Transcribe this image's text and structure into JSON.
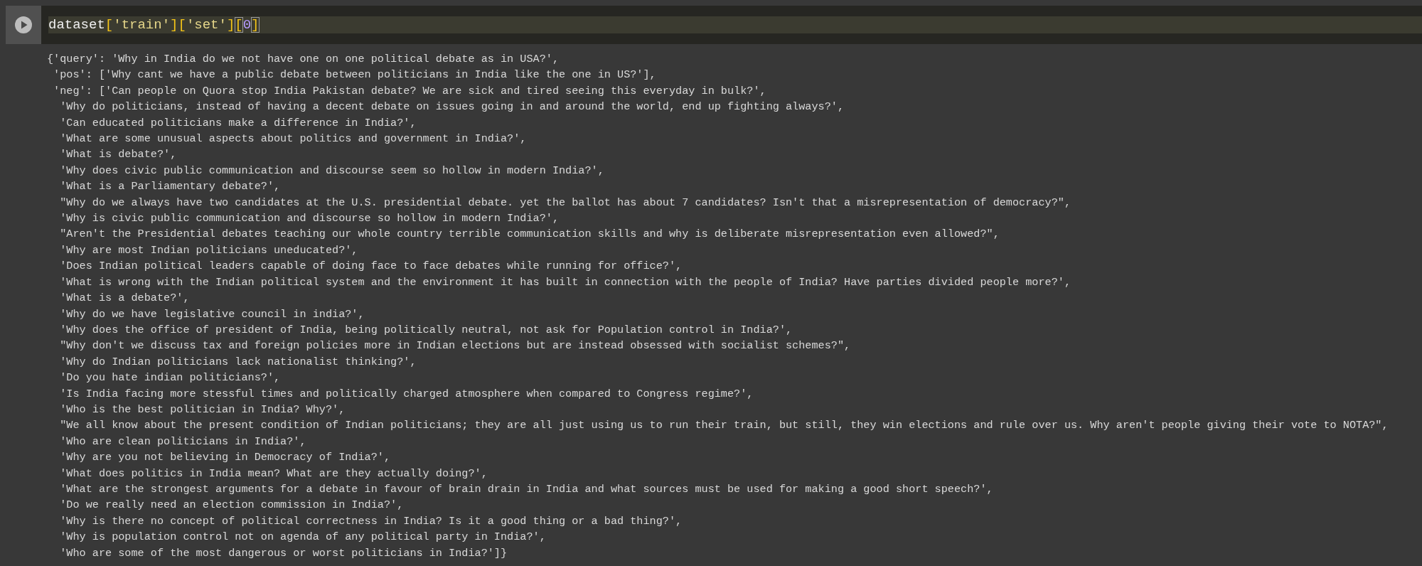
{
  "cell": {
    "code_tokens": [
      {
        "kind": "name",
        "text": "dataset"
      },
      {
        "kind": "bracket",
        "text": "["
      },
      {
        "kind": "string",
        "text": "'train'"
      },
      {
        "kind": "bracket",
        "text": "]"
      },
      {
        "kind": "bracket",
        "text": "["
      },
      {
        "kind": "string",
        "text": "'set'"
      },
      {
        "kind": "bracket",
        "text": "]"
      },
      {
        "kind": "matched_bracket",
        "text": "["
      },
      {
        "kind": "number",
        "text": "0"
      },
      {
        "kind": "matched_bracket",
        "text": "]"
      }
    ]
  },
  "output": {
    "lines": [
      "{'query': 'Why in India do we not have one on one political debate as in USA?',",
      " 'pos': ['Why cant we have a public debate between politicians in India like the one in US?'],",
      " 'neg': ['Can people on Quora stop India Pakistan debate? We are sick and tired seeing this everyday in bulk?',",
      "  'Why do politicians, instead of having a decent debate on issues going in and around the world, end up fighting always?',",
      "  'Can educated politicians make a difference in India?',",
      "  'What are some unusual aspects about politics and government in India?',",
      "  'What is debate?',",
      "  'Why does civic public communication and discourse seem so hollow in modern India?',",
      "  'What is a Parliamentary debate?',",
      "  \"Why do we always have two candidates at the U.S. presidential debate. yet the ballot has about 7 candidates? Isn't that a misrepresentation of democracy?\",",
      "  'Why is civic public communication and discourse so hollow in modern India?',",
      "  \"Aren't the Presidential debates teaching our whole country terrible communication skills and why is deliberate misrepresentation even allowed?\",",
      "  'Why are most Indian politicians uneducated?',",
      "  'Does Indian political leaders capable of doing face to face debates while running for office?',",
      "  'What is wrong with the Indian political system and the environment it has built in connection with the people of India? Have parties divided people more?',",
      "  'What is a debate?',",
      "  'Why do we have legislative council in india?',",
      "  'Why does the office of president of India, being politically neutral, not ask for Population control in India?',",
      "  \"Why don't we discuss tax and foreign policies more in Indian elections but are instead obsessed with socialist schemes?\",",
      "  'Why do Indian politicians lack nationalist thinking?',",
      "  'Do you hate indian politicians?',",
      "  'Is India facing more stessful times and politically charged atmosphere when compared to Congress regime?',",
      "  'Who is the best politician in India? Why?',",
      "  \"We all know about the present condition of Indian politicians; they are all just using us to run their train, but still, they win elections and rule over us. Why aren't people giving their vote to NOTA?\",",
      "  'Who are clean politicians in India?',",
      "  'Why are you not believing in Democracy of India?',",
      "  'What does politics in India mean? What are they actually doing?',",
      "  'What are the strongest arguments for a debate in favour of brain drain in India and what sources must be used for making a good short speech?',",
      "  'Do we really need an election commission in India?',",
      "  'Why is there no concept of political correctness in India? Is it a good thing or a bad thing?',",
      "  'Why is population control not on agenda of any political party in India?',",
      "  'Who are some of the most dangerous or worst politicians in India?']}"
    ]
  }
}
